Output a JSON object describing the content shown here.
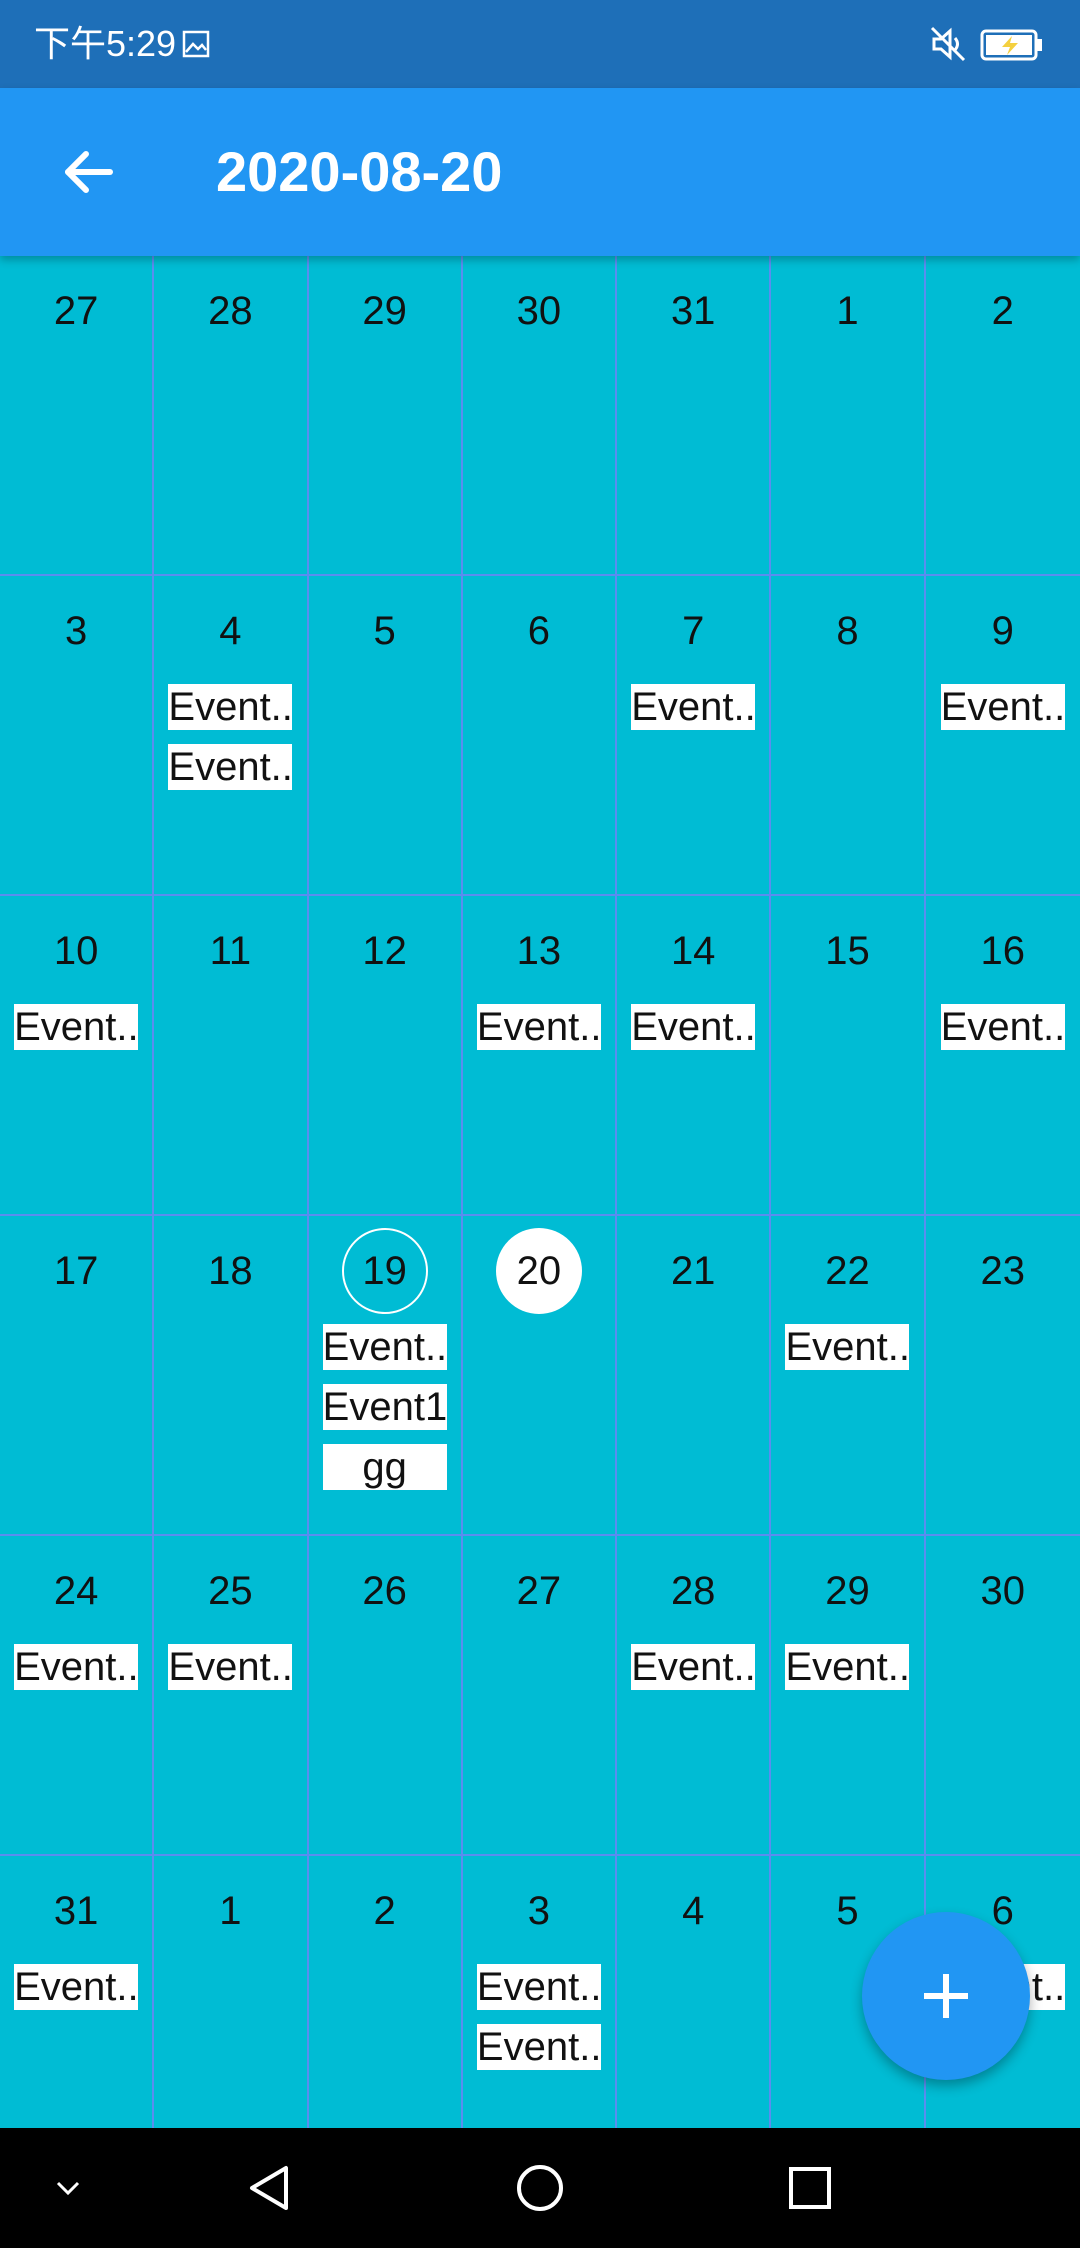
{
  "status_bar": {
    "time": "下午5:29",
    "icons": [
      "image-icon",
      "mute-icon",
      "battery-charging-icon"
    ]
  },
  "app_bar": {
    "title": "2020-08-20",
    "back_icon": "arrow-left-icon"
  },
  "calendar": {
    "weeks": [
      [
        {
          "day": "27",
          "events": []
        },
        {
          "day": "28",
          "events": []
        },
        {
          "day": "29",
          "events": []
        },
        {
          "day": "30",
          "events": []
        },
        {
          "day": "31",
          "events": []
        },
        {
          "day": "1",
          "events": []
        },
        {
          "day": "2",
          "events": []
        }
      ],
      [
        {
          "day": "3",
          "events": []
        },
        {
          "day": "4",
          "events": [
            "Event..",
            "Event.."
          ]
        },
        {
          "day": "5",
          "events": []
        },
        {
          "day": "6",
          "events": []
        },
        {
          "day": "7",
          "events": [
            "Event.."
          ]
        },
        {
          "day": "8",
          "events": []
        },
        {
          "day": "9",
          "events": [
            "Event.."
          ]
        }
      ],
      [
        {
          "day": "10",
          "events": [
            "Event.."
          ]
        },
        {
          "day": "11",
          "events": []
        },
        {
          "day": "12",
          "events": []
        },
        {
          "day": "13",
          "events": [
            "Event.."
          ]
        },
        {
          "day": "14",
          "events": [
            "Event.."
          ]
        },
        {
          "day": "15",
          "events": []
        },
        {
          "day": "16",
          "events": [
            "Event.."
          ]
        }
      ],
      [
        {
          "day": "17",
          "events": []
        },
        {
          "day": "18",
          "events": []
        },
        {
          "day": "19",
          "events": [
            "Event..",
            "Event1",
            "gg"
          ],
          "state": "today"
        },
        {
          "day": "20",
          "events": [],
          "state": "selected"
        },
        {
          "day": "21",
          "events": []
        },
        {
          "day": "22",
          "events": [
            "Event.."
          ]
        },
        {
          "day": "23",
          "events": []
        }
      ],
      [
        {
          "day": "24",
          "events": [
            "Event.."
          ]
        },
        {
          "day": "25",
          "events": [
            "Event.."
          ]
        },
        {
          "day": "26",
          "events": []
        },
        {
          "day": "27",
          "events": []
        },
        {
          "day": "28",
          "events": [
            "Event.."
          ]
        },
        {
          "day": "29",
          "events": [
            "Event.."
          ]
        },
        {
          "day": "30",
          "events": []
        }
      ],
      [
        {
          "day": "31",
          "events": [
            "Event.."
          ]
        },
        {
          "day": "1",
          "events": []
        },
        {
          "day": "2",
          "events": []
        },
        {
          "day": "3",
          "events": [
            "Event..",
            "Event.."
          ]
        },
        {
          "day": "4",
          "events": []
        },
        {
          "day": "5",
          "events": []
        },
        {
          "day": "6",
          "events": [
            "Event.."
          ]
        }
      ]
    ]
  },
  "fab": {
    "icon": "plus-icon"
  },
  "nav_bar": {
    "icons": [
      "chevron-down-icon",
      "back-triangle-icon",
      "home-circle-icon",
      "recents-square-icon"
    ]
  },
  "colors": {
    "status_bar": "#1E6FB8",
    "app_bar": "#2196F3",
    "calendar_bg": "#00BCD4",
    "grid_line": "#5B8DEF",
    "fab": "#2196F3"
  }
}
